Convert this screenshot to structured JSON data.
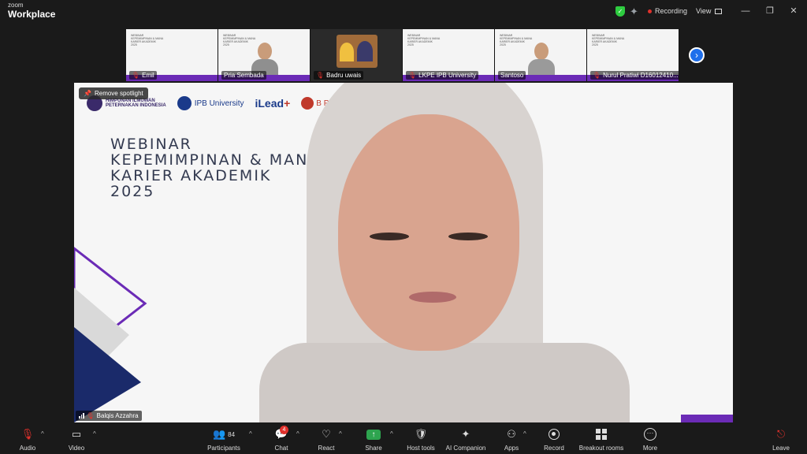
{
  "app": {
    "logo_line1": "zoom",
    "logo_line2": "Workplace",
    "recording_label": "Recording",
    "view_label": "View",
    "window_controls": [
      "minimize",
      "restore",
      "close"
    ]
  },
  "thumbnails": [
    {
      "name": "Emil",
      "type": "slide",
      "muted": true
    },
    {
      "name": "Pria Sembada",
      "type": "slide-person",
      "muted": false
    },
    {
      "name": "Badru uwais",
      "type": "photo",
      "muted": true
    },
    {
      "name": "LKPE IPB University",
      "type": "slide",
      "muted": true
    },
    {
      "name": "Santoso",
      "type": "slide-person",
      "muted": false
    },
    {
      "name": "Nurul Pratiwi D16012410...",
      "type": "slide",
      "muted": true
    }
  ],
  "main_video": {
    "spotlight_button": "Remove spotlight",
    "speaker_name": "Balqis Azzahra",
    "slide_title_lines": [
      "WEBINAR",
      "KEPEMIMPINAN & MANA",
      "KARIER AKADEMIK",
      "2025"
    ],
    "slide_logos": {
      "org_text_line1": "HIMPUNAN ILMUWAN",
      "org_text_line2": "PETERNAKAN INDONESIA",
      "ipb_text": "IPB University",
      "ilead_text": "iLead",
      "ilead_plus": "+",
      "bp_text": "B P"
    },
    "colors": {
      "accent_purple": "#6b2bb6",
      "navy": "#1a2a6a"
    }
  },
  "toolbar": {
    "audio_label": "Audio",
    "video_label": "Video",
    "participants_label": "Participants",
    "participants_count": "84",
    "chat_label": "Chat",
    "chat_badge": "4",
    "react_label": "React",
    "share_label": "Share",
    "host_tools_label": "Host tools",
    "ai_companion_label": "AI Companion",
    "apps_label": "Apps",
    "record_label": "Record",
    "breakout_label": "Breakout rooms",
    "more_label": "More",
    "leave_label": "Leave"
  }
}
